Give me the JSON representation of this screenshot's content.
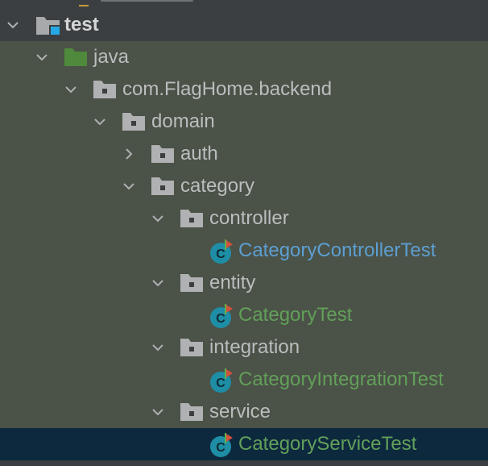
{
  "colors": {
    "background": "#3c3f41",
    "test_scope_background": "#4b5247",
    "selection_background": "#0d293e",
    "text": "#bbbdbf",
    "test_class_text": "#62a05a",
    "modified_class_text": "#5c9fd2",
    "source_folder": "#4f8a3c",
    "package_icon": "#afb1b3",
    "class_icon": "#1e8ea6"
  },
  "tree": {
    "nodes": [
      {
        "label": "test",
        "icon": "test-folder-icon",
        "expanded": true
      },
      {
        "label": "java",
        "icon": "source-folder-icon",
        "expanded": true
      },
      {
        "label": "com.FlagHome.backend",
        "icon": "package-icon",
        "expanded": true
      },
      {
        "label": "domain",
        "icon": "package-icon",
        "expanded": true
      },
      {
        "label": "auth",
        "icon": "package-icon",
        "expanded": false
      },
      {
        "label": "category",
        "icon": "package-icon",
        "expanded": true
      },
      {
        "label": "controller",
        "icon": "package-icon",
        "expanded": true
      },
      {
        "label": "CategoryControllerTest",
        "icon": "test-class-icon"
      },
      {
        "label": "entity",
        "icon": "package-icon",
        "expanded": true
      },
      {
        "label": "CategoryTest",
        "icon": "test-class-icon"
      },
      {
        "label": "integration",
        "icon": "package-icon",
        "expanded": true
      },
      {
        "label": "CategoryIntegrationTest",
        "icon": "test-class-icon"
      },
      {
        "label": "service",
        "icon": "package-icon",
        "expanded": true
      },
      {
        "label": "CategoryServiceTest",
        "icon": "test-class-icon",
        "selected": true
      }
    ]
  },
  "icon_letter": "C"
}
